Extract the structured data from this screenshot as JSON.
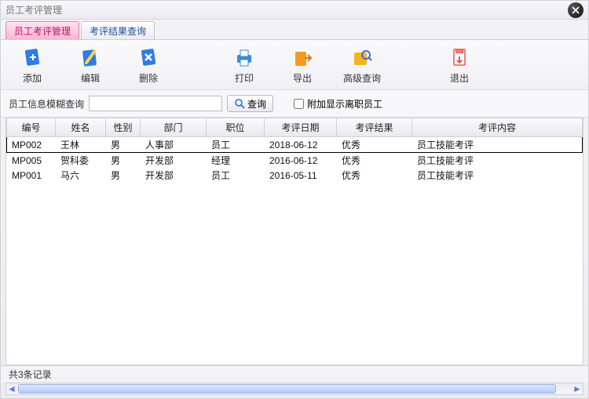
{
  "window": {
    "title": "员工考评管理"
  },
  "tabs": [
    {
      "label": "员工考评管理",
      "active": true
    },
    {
      "label": "考评结果查询",
      "active": false
    }
  ],
  "toolbar": [
    {
      "name": "add-button",
      "label": "添加",
      "icon": "add-icon",
      "color": "#2e7be6"
    },
    {
      "name": "edit-button",
      "label": "编辑",
      "icon": "edit-icon",
      "color": "#2e7be6"
    },
    {
      "name": "delete-button",
      "label": "删除",
      "icon": "delete-icon",
      "color": "#2e7be6"
    },
    {
      "name": "print-button",
      "label": "打印",
      "icon": "print-icon",
      "color": "#3b8bd6"
    },
    {
      "name": "export-button",
      "label": "导出",
      "icon": "export-icon",
      "color": "#f59a1e"
    },
    {
      "name": "adv-search-button",
      "label": "高级查询",
      "icon": "adv-search-icon",
      "color": "#f5b31e"
    },
    {
      "name": "exit-button",
      "label": "退出",
      "icon": "exit-icon",
      "color": "#e45a4a"
    }
  ],
  "search": {
    "label": "员工信息模糊查询",
    "value": "",
    "placeholder": "",
    "query_label": "查询",
    "checkbox_label": "附加显示离职员工",
    "checkbox_checked": false
  },
  "table": {
    "columns": [
      "编号",
      "姓名",
      "性别",
      "部门",
      "职位",
      "考评日期",
      "考评结果",
      "考评内容"
    ],
    "rows": [
      {
        "selected": true,
        "cells": [
          "MP002",
          "王林",
          "男",
          "人事部",
          "员工",
          "2018-06-12",
          "优秀",
          "员工技能考评"
        ]
      },
      {
        "selected": false,
        "cells": [
          "MP005",
          "贺科委",
          "男",
          "开发部",
          "经理",
          "2016-06-12",
          "优秀",
          "员工技能考评"
        ]
      },
      {
        "selected": false,
        "cells": [
          "MP001",
          "马六",
          "男",
          "开发部",
          "员工",
          "2016-05-11",
          "优秀",
          "员工技能考评"
        ]
      }
    ]
  },
  "status": {
    "text": "共3条记录"
  }
}
